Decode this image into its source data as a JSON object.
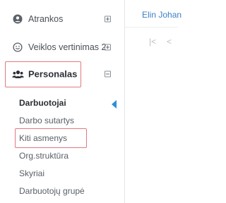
{
  "sidebar": {
    "items": [
      {
        "label": "Atrankos",
        "icon": "user-circle-icon",
        "toggle": "plus"
      },
      {
        "label": "Veiklos vertinimas 2",
        "icon": "smile-icon",
        "toggle": "plus"
      },
      {
        "label": "Personalas",
        "icon": "users-icon",
        "toggle": "minus"
      }
    ],
    "submenu": [
      {
        "label": "Darbuotojai"
      },
      {
        "label": "Darbo sutartys"
      },
      {
        "label": "Kiti asmenys"
      },
      {
        "label": "Org.struktūra"
      },
      {
        "label": "Skyriai"
      },
      {
        "label": "Darbuotojų grupė"
      }
    ]
  },
  "main": {
    "link_text": "Elin Johan",
    "pager_prev": "|<",
    "pager_back": "<"
  },
  "colors": {
    "accent": "#2d8fd5",
    "highlight": "#e07a7f",
    "link": "#3d7fc4"
  }
}
